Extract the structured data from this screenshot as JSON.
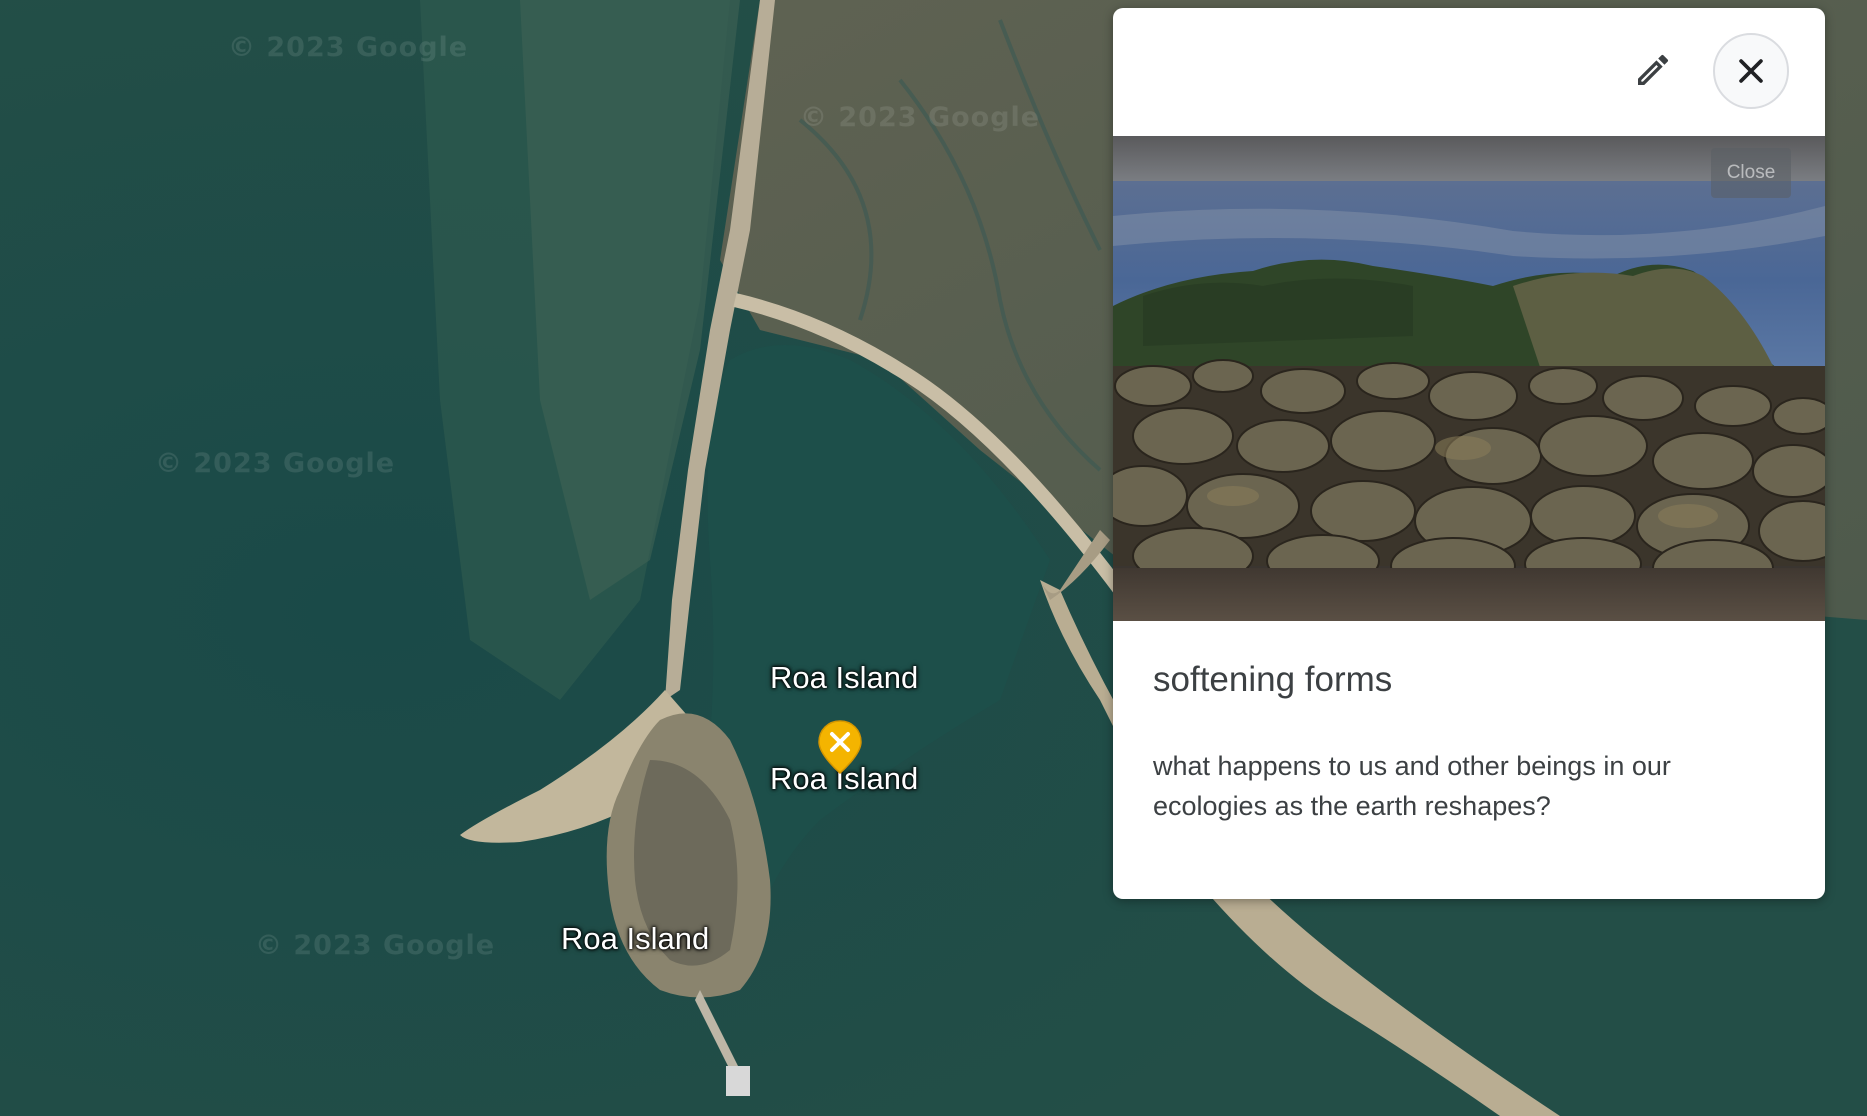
{
  "map": {
    "watermarks": [
      "© 2023 Google",
      "© 2023 Google",
      "© 2023 Google",
      "© 2023 Google"
    ],
    "labels": [
      "Roa Island",
      "Roa Island",
      "Roa Island"
    ],
    "pin_icon": "close-icon",
    "colors": {
      "water": "#1f4a45",
      "land": "#6b6a58",
      "pin": "#f4b400"
    }
  },
  "card": {
    "edit_icon": "pencil-icon",
    "close_icon": "close-icon",
    "close_tooltip": "Close",
    "title": "softening forms",
    "description": "what happens to us and other beings in our ecologies as the earth reshapes?"
  }
}
